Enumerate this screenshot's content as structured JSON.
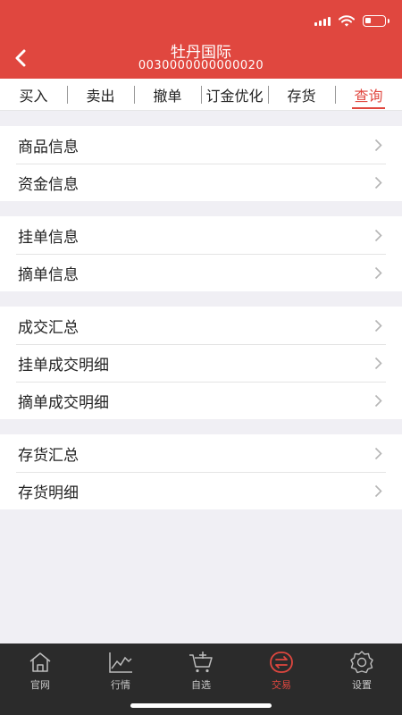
{
  "header": {
    "title": "牡丹国际",
    "account": "0030000000000020",
    "back_icon": "chevron-left-icon",
    "bg_color": "#e0473f"
  },
  "tabs": [
    {
      "label": "买入",
      "active": false
    },
    {
      "label": "卖出",
      "active": false
    },
    {
      "label": "撤单",
      "active": false
    },
    {
      "label": "订金优化",
      "active": false
    },
    {
      "label": "存货",
      "active": false
    },
    {
      "label": "查询",
      "active": true
    }
  ],
  "groups": [
    {
      "items": [
        {
          "label": "商品信息"
        },
        {
          "label": "资金信息"
        }
      ]
    },
    {
      "items": [
        {
          "label": "挂单信息"
        },
        {
          "label": "摘单信息"
        }
      ]
    },
    {
      "items": [
        {
          "label": "成交汇总"
        },
        {
          "label": "挂单成交明细"
        },
        {
          "label": "摘单成交明细"
        }
      ]
    },
    {
      "items": [
        {
          "label": "存货汇总"
        },
        {
          "label": "存货明细"
        }
      ]
    }
  ],
  "tabbar": [
    {
      "label": "官网",
      "icon": "home-icon",
      "active": false
    },
    {
      "label": "行情",
      "icon": "chart-icon",
      "active": false
    },
    {
      "label": "自选",
      "icon": "cart-add-icon",
      "active": false
    },
    {
      "label": "交易",
      "icon": "exchange-icon",
      "active": true
    },
    {
      "label": "设置",
      "icon": "gear-icon",
      "active": false
    }
  ],
  "colors": {
    "accent": "#e0473f",
    "tabbar_bg": "#2b2b2b",
    "page_bg": "#f0eff4"
  }
}
